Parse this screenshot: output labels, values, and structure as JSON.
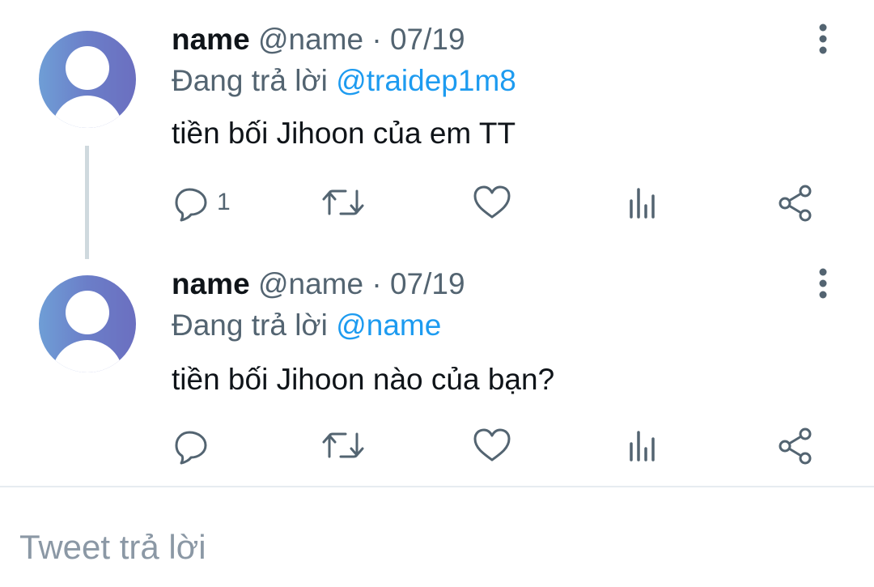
{
  "colors": {
    "accent": "#1d9bf0",
    "secondary_text": "#536471",
    "primary_text": "#0f1419",
    "thread_line": "#cfd9de",
    "avatar_gradient_start": "#6f9ed6",
    "avatar_gradient_end": "#6b6fc0"
  },
  "tweets": [
    {
      "display_name": "name",
      "handle": "@name",
      "separator": "·",
      "date": "07/19",
      "replying_prefix": "Đang trả lời",
      "replying_to": "@traidep1m8",
      "content": "tiền bối Jihoon của em TT",
      "reply_count": "1",
      "icons": [
        "reply-icon",
        "retweet-icon",
        "like-icon",
        "views-icon",
        "share-icon",
        "more-options-icon"
      ]
    },
    {
      "display_name": "name",
      "handle": "@name",
      "separator": "·",
      "date": "07/19",
      "replying_prefix": "Đang trả lời",
      "replying_to": "@name",
      "content": "tiền bối Jihoon nào của bạn?",
      "reply_count": "",
      "icons": [
        "reply-icon",
        "retweet-icon",
        "like-icon",
        "views-icon",
        "share-icon",
        "more-options-icon"
      ]
    }
  ],
  "reply_box": {
    "placeholder": "Tweet trả lời"
  }
}
